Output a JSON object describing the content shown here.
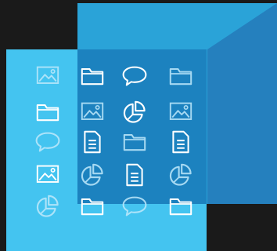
{
  "colors": {
    "background": "#1a1a1a",
    "back_panel": "#2aa3d8",
    "back_panel_shadow": "#2580be",
    "front_panel": "#44c4f0",
    "overlap_panel": "#1c82bf",
    "icon_bright": "#ffffff",
    "icon_dim": "#bfe9fb"
  },
  "icon_grid": {
    "rows": [
      [
        "image-icon",
        "folder-icon",
        "chat-bubble-icon",
        "folder-icon"
      ],
      [
        "folder-icon",
        "image-icon",
        "pie-chart-icon",
        "image-icon"
      ],
      [
        "chat-bubble-icon",
        "document-icon",
        "folder-icon",
        "document-icon"
      ],
      [
        "image-icon",
        "pie-chart-icon",
        "document-icon",
        "pie-chart-icon"
      ],
      [
        "pie-chart-icon",
        "folder-icon",
        "chat-bubble-icon",
        "folder-icon"
      ]
    ],
    "dimmed": [
      [
        true,
        false,
        false,
        true
      ],
      [
        false,
        true,
        false,
        true
      ],
      [
        true,
        false,
        true,
        false
      ],
      [
        false,
        true,
        false,
        true
      ],
      [
        true,
        false,
        true,
        false
      ]
    ]
  }
}
